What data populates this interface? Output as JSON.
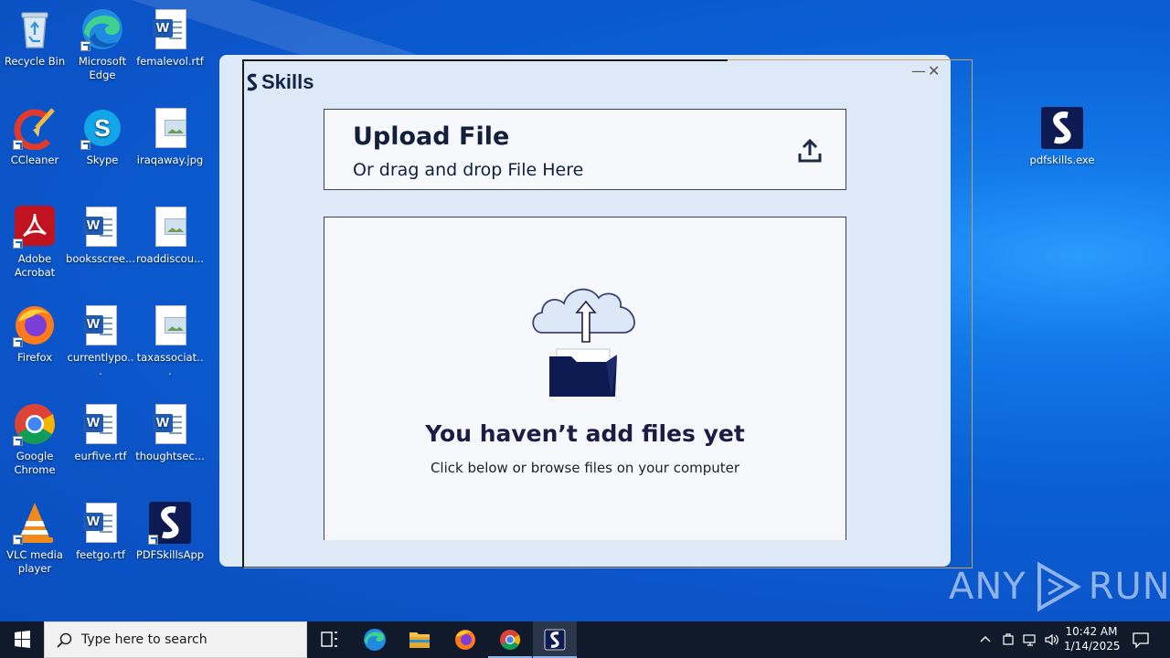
{
  "desktop": {
    "icons": [
      {
        "label": "Recycle Bin",
        "icon": "recycle-bin-icon"
      },
      {
        "label": "Microsoft Edge",
        "icon": "edge-icon"
      },
      {
        "label": "femalevol.rtf",
        "icon": "word-doc-icon"
      },
      {
        "label": "CCleaner",
        "icon": "ccleaner-icon"
      },
      {
        "label": "Skype",
        "icon": "skype-icon"
      },
      {
        "label": "iraqaway.jpg",
        "icon": "image-file-icon"
      },
      {
        "label": "Adobe Acrobat",
        "icon": "acrobat-icon"
      },
      {
        "label": "booksscree...",
        "icon": "word-doc-icon"
      },
      {
        "label": "roaddiscou...",
        "icon": "image-file-icon"
      },
      {
        "label": "Firefox",
        "icon": "firefox-icon"
      },
      {
        "label": "currentlypo...",
        "icon": "word-doc-icon"
      },
      {
        "label": "taxassociat...",
        "icon": "image-file-icon"
      },
      {
        "label": "Google Chrome",
        "icon": "chrome-icon"
      },
      {
        "label": "eurfive.rtf",
        "icon": "word-doc-icon"
      },
      {
        "label": "thoughtsec...",
        "icon": "word-doc-icon"
      },
      {
        "label": "VLC media player",
        "icon": "vlc-icon"
      },
      {
        "label": "feetgo.rtf",
        "icon": "word-doc-icon"
      },
      {
        "label": "PDFSkillsApp",
        "icon": "pdfskills-icon"
      },
      {
        "label": "pdfskills.exe",
        "icon": "pdfskills-icon"
      }
    ]
  },
  "app": {
    "brand": "Skills",
    "minimize": "—",
    "close": "✕",
    "upload": {
      "title": "Upload File",
      "subtitle": "Or drag and drop File Here",
      "icon": "upload-icon"
    },
    "empty_state": {
      "title": "You haven’t add files yet",
      "subtitle": "Click below or browse files on your computer",
      "icon": "cloud-folder-upload-icon"
    }
  },
  "watermark": {
    "left": "ANY",
    "right": "RUN"
  },
  "taskbar": {
    "search_placeholder": "Type here to search",
    "time": "10:42 AM",
    "date": "1/14/2025",
    "apps": [
      "task-view-icon",
      "edge-icon",
      "file-explorer-icon",
      "firefox-icon",
      "chrome-icon",
      "pdfskills-icon"
    ]
  }
}
